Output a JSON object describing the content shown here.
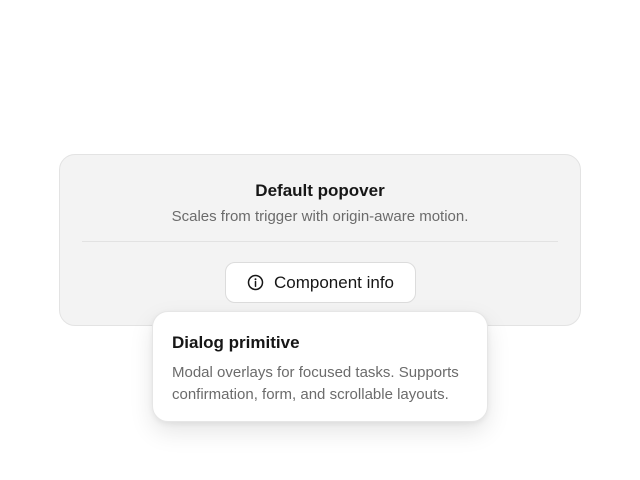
{
  "card": {
    "title": "Default popover",
    "subtitle": "Scales from trigger with origin-aware motion."
  },
  "trigger": {
    "icon": "info-icon",
    "label": "Component info"
  },
  "popover": {
    "title": "Dialog primitive",
    "body": "Modal overlays for focused tasks. Supports confirmation, form, and scrollable layouts."
  },
  "colors": {
    "background": "#ffffff",
    "card_background": "#f3f3f3",
    "text_primary": "#161616",
    "text_secondary": "#6b6b6b"
  }
}
